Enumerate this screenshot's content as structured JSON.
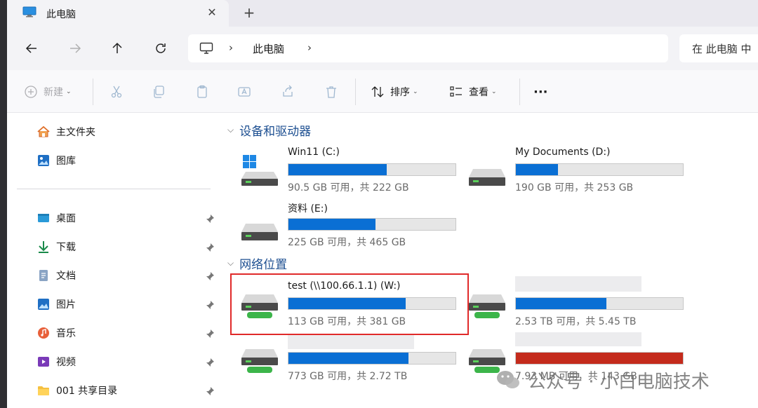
{
  "tab": {
    "title": "此电脑",
    "close": "✕",
    "new": "+"
  },
  "address": {
    "crumb": "此电脑",
    "sep1": "›",
    "sep2": "›"
  },
  "search": {
    "placeholder": "在 此电脑 中"
  },
  "toolbar": {
    "new": "新建",
    "sort": "排序",
    "view": "查看",
    "more": "···"
  },
  "sidebar": {
    "top": [
      {
        "label": "主文件夹",
        "icon": "home-icon"
      },
      {
        "label": "图库",
        "icon": "gallery-icon"
      }
    ],
    "pinned": [
      {
        "label": "桌面",
        "icon": "desktop-icon"
      },
      {
        "label": "下载",
        "icon": "download-icon"
      },
      {
        "label": "文档",
        "icon": "document-icon"
      },
      {
        "label": "图片",
        "icon": "pictures-icon"
      },
      {
        "label": "音乐",
        "icon": "music-icon"
      },
      {
        "label": "视频",
        "icon": "video-icon"
      },
      {
        "label": "001 共享目录",
        "icon": "folder-icon"
      }
    ]
  },
  "sections": {
    "devices": "设备和驱动器",
    "network": "网络位置"
  },
  "drives": {
    "c": {
      "name": "Win11 (C:)",
      "free": "90.5 GB 可用，共 222 GB",
      "used_fraction": 0.59
    },
    "d": {
      "name": "My Documents (D:)",
      "free": "190 GB 可用，共 253 GB",
      "used_fraction": 0.25
    },
    "e": {
      "name": "资料 (E:)",
      "free": "225 GB 可用，共 465 GB",
      "used_fraction": 0.52
    },
    "w": {
      "name": "test (\\\\100.66.1.1) (W:)",
      "free": "113 GB 可用，共 381 GB",
      "used_fraction": 0.7
    },
    "n2": {
      "name": "",
      "free": "2.53 TB 可用，共 5.45 TB",
      "used_fraction": 0.54
    },
    "n3": {
      "name": "",
      "free": "773 GB 可用，共 2.72 TB",
      "used_fraction": 0.72
    },
    "n4": {
      "name": "",
      "free": "7.93 MB 可用，共 143 GB",
      "used_fraction": 0.999
    }
  },
  "watermark": {
    "text": "公众号 · 小白电脑技术"
  },
  "colors": {
    "accent": "#0a6fd4",
    "critical": "#c42b1c",
    "section": "#1d4f91",
    "highlight": "#e02a2a"
  }
}
